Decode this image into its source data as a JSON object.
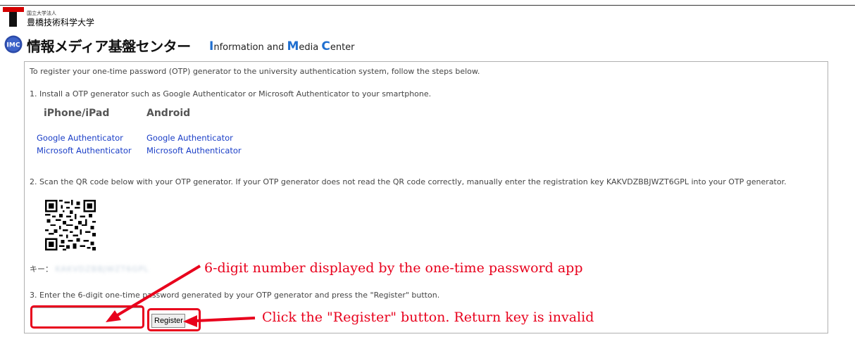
{
  "header": {
    "university_small": "国立大学法人",
    "university_name": "豊橋技術科学大学",
    "center_jp": "情報メディア基盤センター",
    "center_en": {
      "I": "I",
      "i_rest": "nformation and ",
      "M": "M",
      "m_rest": "edia ",
      "C": "C",
      "c_rest": "enter"
    },
    "imc_icon_text": "IMC"
  },
  "content": {
    "intro": "To register your one-time password (OTP) generator to the university authentication system, follow the steps below.",
    "step1": "1. Install a OTP generator such as Google Authenticator or Microsoft Authenticator to your smartphone.",
    "iphone_header": "iPhone/iPad",
    "android_header": "Android",
    "links": {
      "iphone_google": "Google Authenticator",
      "iphone_microsoft": "Microsoft Authenticator",
      "android_google": "Google Authenticator",
      "android_microsoft": "Microsoft Authenticator"
    },
    "step2": "2. Scan the QR code below with your OTP generator. If your OTP generator does not read the QR code correctly, manually enter the registration key KAKVDZBBJWZT6GPL into your OTP generator.",
    "key_label": "キー：",
    "key_value": "KAKVDZBBJWZT6GPL",
    "step3": "3. Enter the 6-digit one-time password generated by your OTP generator and press the \"Register\" button.",
    "otp_input_value": "",
    "register_label": "Register"
  },
  "annotations": {
    "input_note": "6-digit number displayed by the one-time password app",
    "button_note": "Click the \"Register\" button. Return key is invalid",
    "color": "#e8001c"
  }
}
